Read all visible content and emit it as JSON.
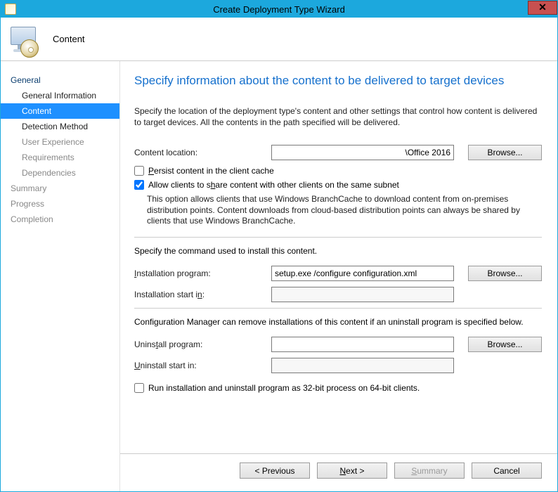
{
  "window": {
    "title": "Create Deployment Type Wizard",
    "close_glyph": "✕"
  },
  "header": {
    "label": "Content"
  },
  "sidebar": {
    "items": [
      {
        "label": "General",
        "type": "top"
      },
      {
        "label": "General Information",
        "type": "sub"
      },
      {
        "label": "Content",
        "type": "sub",
        "active": true
      },
      {
        "label": "Detection Method",
        "type": "sub"
      },
      {
        "label": "User Experience",
        "type": "subgray"
      },
      {
        "label": "Requirements",
        "type": "subgray"
      },
      {
        "label": "Dependencies",
        "type": "subgray"
      },
      {
        "label": "Summary",
        "type": "topgray"
      },
      {
        "label": "Progress",
        "type": "topgray"
      },
      {
        "label": "Completion",
        "type": "topgray"
      }
    ]
  },
  "page": {
    "title": "Specify information about the content to be delivered to target devices",
    "description": "Specify the location of the deployment type's content and other settings that control how content is delivered to target devices. All the contents in the path specified will be delivered.",
    "content_location_label": "Content location:",
    "content_location_value": "\\Office 2016",
    "browse_label": "Browse...",
    "persist_label": "Persist content in the client cache",
    "persist_checked": false,
    "share_label": "Allow clients to share content with other clients on the same subnet",
    "share_checked": true,
    "share_help": "This option allows clients that use Windows BranchCache to download content from on-premises distribution points. Content downloads from cloud-based distribution points can always be shared by clients that use Windows BranchCache.",
    "install_section_text": "Specify the command used to install this content.",
    "install_program_label": "Installation program:",
    "install_program_value": "setup.exe /configure configuration.xml",
    "install_start_label": "Installation start in:",
    "install_start_value": "",
    "uninstall_section_text": "Configuration Manager can remove installations of this content if an uninstall program is specified below.",
    "uninstall_program_label": "Uninstall program:",
    "uninstall_program_value": "",
    "uninstall_start_label": "Uninstall start in:",
    "uninstall_start_value": "",
    "run32_label": "Run installation and uninstall program as 32-bit process on 64-bit clients.",
    "run32_checked": false
  },
  "footer": {
    "previous": "< Previous",
    "next": "Next >",
    "summary": "Summary",
    "cancel": "Cancel"
  }
}
